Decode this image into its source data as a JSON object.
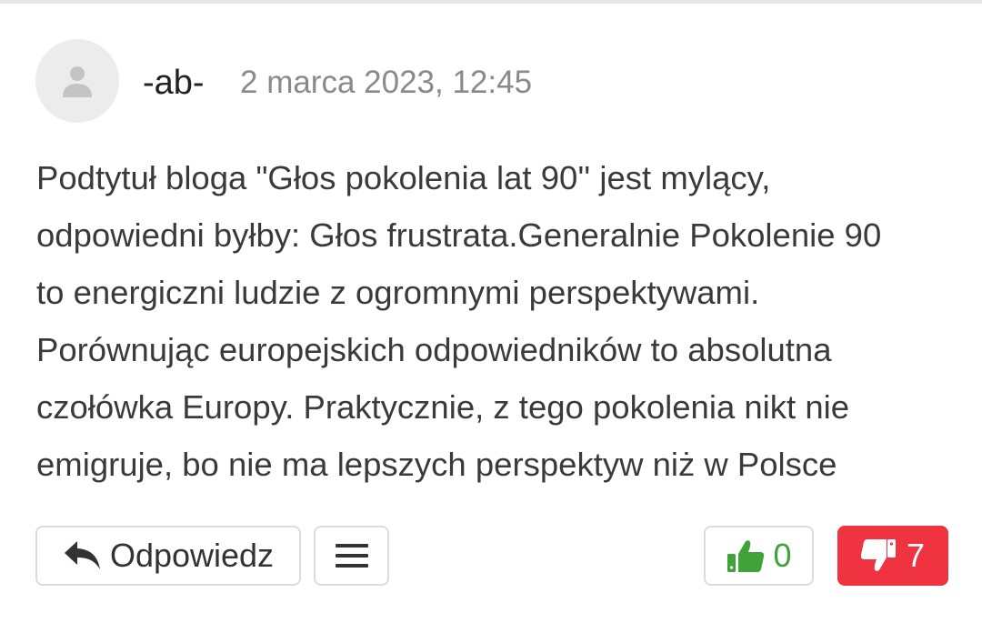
{
  "comment": {
    "author": "-ab-",
    "timestamp": "2 marca 2023, 12:45",
    "avatar_icon": "user-silhouette-icon",
    "body_lines": [
      "Podtytuł bloga \"Głos pokolenia lat 90'' jest mylący,",
      "odpowiedni byłby: Głos frustrata.Generalnie Pokolenie 90",
      "to energiczni ludzie z ogromnymi perspektywami.",
      "Porównując europejskich odpowiedników to absolutna",
      "czołówka Europy. Praktycznie, z tego pokolenia nikt nie",
      "emigruje, bo nie ma lepszych perspektyw niż w Polsce"
    ]
  },
  "actions": {
    "reply_label": "Odpowiedz",
    "reply_icon": "reply-arrow-icon",
    "menu_icon": "hamburger-menu-icon",
    "upvote_icon": "thumbs-up-icon",
    "upvote_count": "0",
    "downvote_icon": "thumbs-down-icon",
    "downvote_count": "7"
  },
  "colors": {
    "upvote": "#3fa33a",
    "downvote_bg": "#ef3340",
    "timestamp": "#8a8a8a",
    "body_text": "#3a3a3a"
  }
}
